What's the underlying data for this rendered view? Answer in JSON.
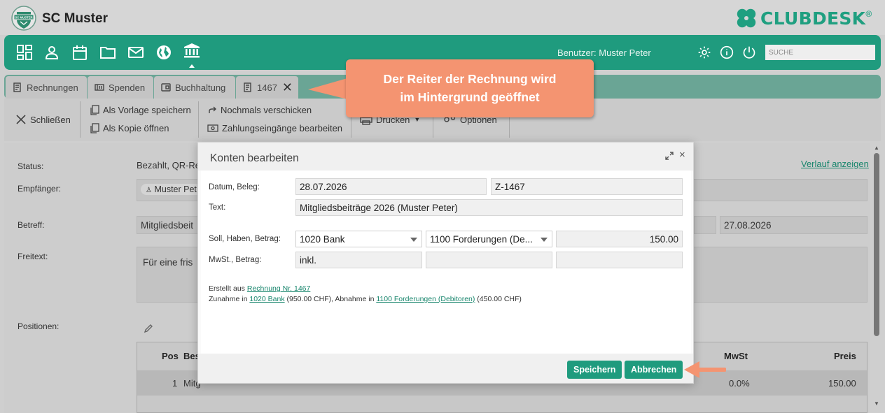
{
  "app": {
    "club_name": "SC Muster",
    "brand_name": "CLUBDESK",
    "brand_mark": "®",
    "logo_text": "SC MUSTER",
    "accent_color": "#1f9b7e"
  },
  "nav": {
    "icons": [
      "dashboard-icon",
      "person-icon",
      "calendar-icon",
      "folder-icon",
      "mail-icon",
      "globe-icon",
      "bank-icon"
    ],
    "user_label": "Benutzer: Muster Peter",
    "search_placeholder": "SUCHE",
    "right_icons": [
      "gear-icon",
      "info-icon",
      "power-icon"
    ]
  },
  "tabs": [
    {
      "label": "Rechnungen",
      "icon": "invoice-icon"
    },
    {
      "label": "Spenden",
      "icon": "donation-icon"
    },
    {
      "label": "Buchhaltung",
      "icon": "wallet-icon"
    },
    {
      "label": "1467",
      "icon": "invoice-icon",
      "active": true,
      "close": "✕"
    }
  ],
  "toolbar": {
    "close_label": "Schließen",
    "save_template_label": "Als Vorlage speichern",
    "open_copy_label": "Als Kopie öffnen",
    "resend_label": "Nochmals verschicken",
    "payments_label": "Zahlungseingänge bearbeiten",
    "print_label": "Drucken",
    "options_label": "Optionen"
  },
  "form": {
    "status_label": "Status:",
    "status_value": "Bezahlt, QR-Re",
    "history_link": "Verlauf anzeigen",
    "recipient_label": "Empfänger:",
    "recipient_value": "Muster Pet",
    "subject_label": "Betreff:",
    "subject_value": "Mitgliedsbeit",
    "due_date": "27.08.2026",
    "freetext_label": "Freitext:",
    "freetext_value": "Für eine fris",
    "positions_label": "Positionen:"
  },
  "positions_table": {
    "headers": {
      "pos": "Pos",
      "desc": "Bes",
      "vat": "MwSt",
      "price": "Preis"
    },
    "rows": [
      {
        "pos": "1",
        "desc": "Mitg",
        "vat": "0.0%",
        "price": "150.00"
      }
    ]
  },
  "dialog": {
    "title": "Konten bearbeiten",
    "close": "×",
    "date_label": "Datum, Beleg:",
    "date_value": "28.07.2026",
    "voucher_value": "Z-1467",
    "text_label": "Text:",
    "text_value": "Mitgliedsbeiträge 2026 (Muster Peter)",
    "entry_label": "Soll, Haben, Betrag:",
    "debit_account": "1020 Bank",
    "credit_account": "1100 Forderungen (De...",
    "amount": "150.00",
    "vat_label": "MwSt., Betrag:",
    "vat_value": "inkl.",
    "info_line1_prefix": "Erstellt aus ",
    "info_line1_link": "Rechnung Nr. 1467",
    "info_line2_prefix": "Zunahme in ",
    "info_line2_link1": "1020 Bank",
    "info_line2_mid": " (950.00 CHF), Abnahme in ",
    "info_line2_link2": "1100 Forderungen (Debitoren)",
    "info_line2_suffix": " (450.00 CHF)",
    "save_label": "Speichern",
    "cancel_label": "Abbrechen"
  },
  "callout": {
    "line1": "Der Reiter der Rechnung wird",
    "line2": "im Hintergrund geöffnet",
    "color": "#f49471"
  }
}
